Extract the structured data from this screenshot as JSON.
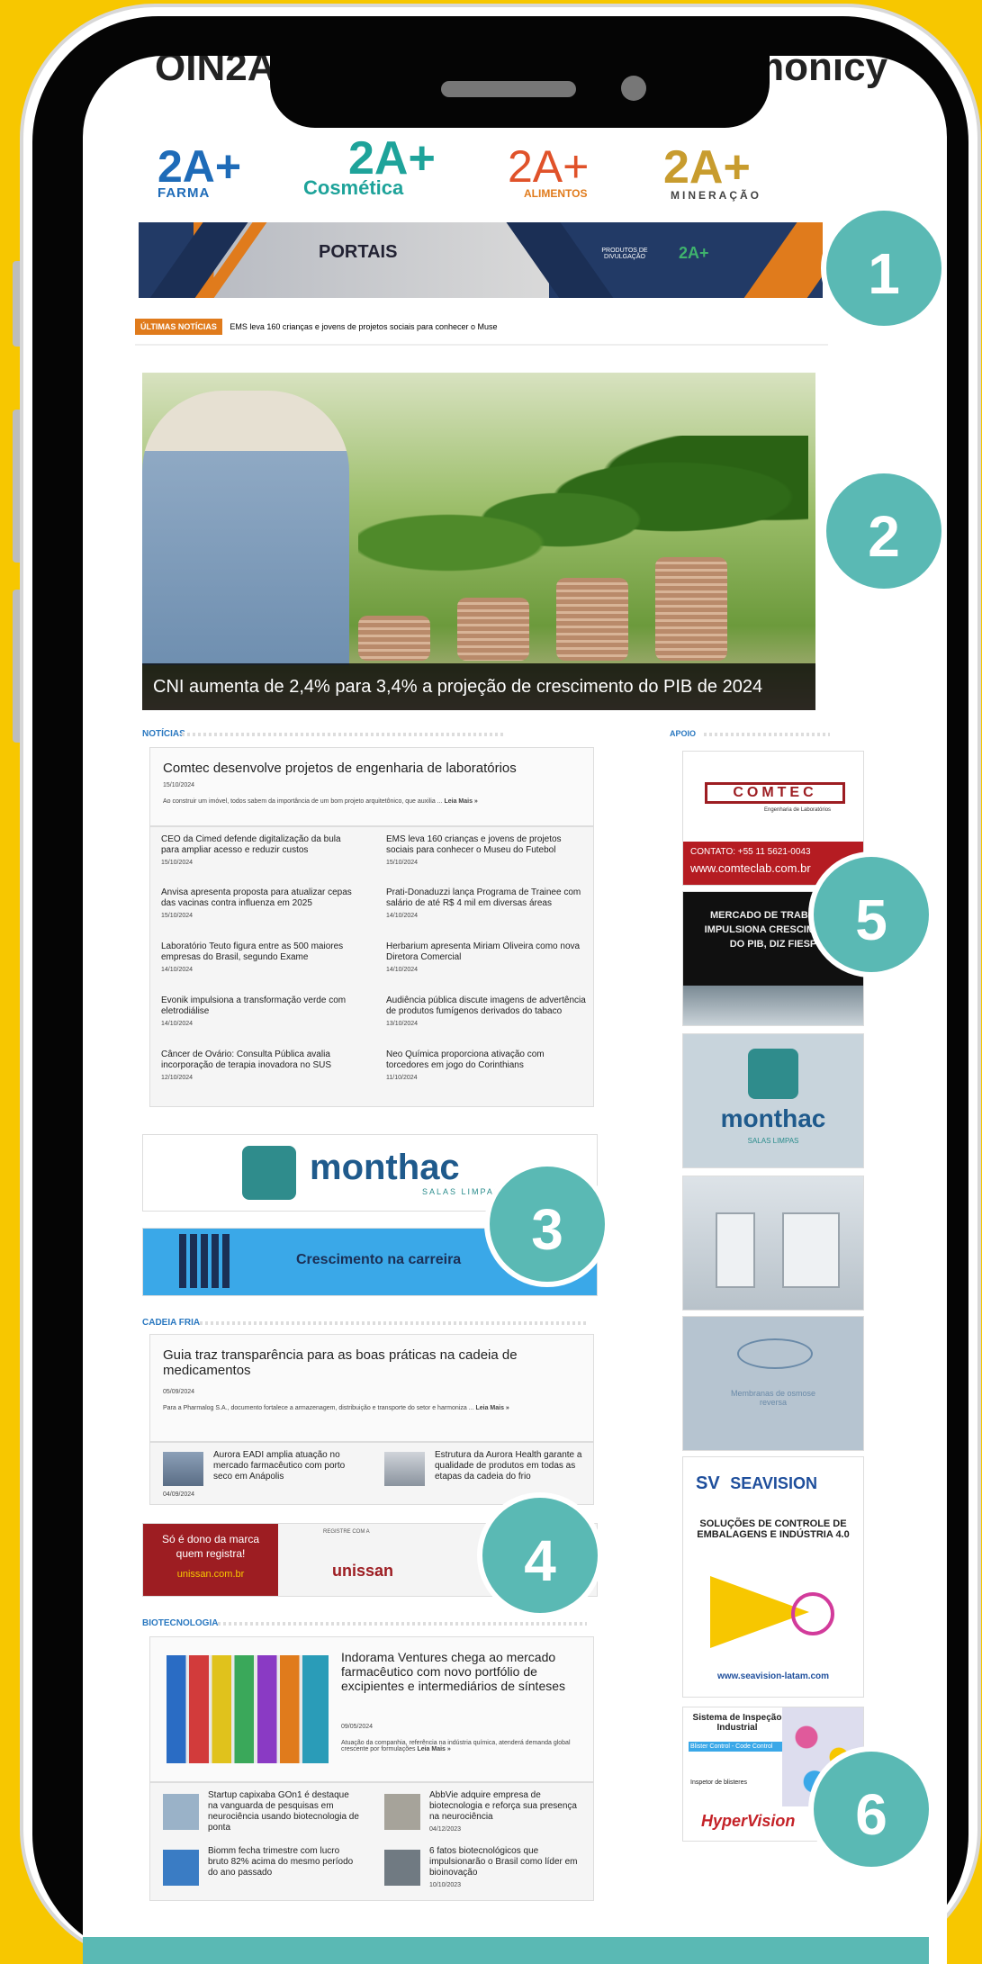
{
  "header": {
    "cut_text_left": "OIN2A",
    "cut_text_right": "monicy"
  },
  "brands": {
    "farma": {
      "main": "2A+",
      "sub": "FARMA"
    },
    "cosmetica": {
      "main": "2A+",
      "sub": "Cosmética"
    },
    "alimentos": {
      "main": "2A+",
      "sub": "ALIMENTOS"
    },
    "mineracao": {
      "main": "2A+",
      "sub": "MINERAÇÃO"
    }
  },
  "banner_portais": {
    "title": "PORTAIS",
    "sub": "PRODUTOS DE DIVULGAÇÃO",
    "brand": "2A+"
  },
  "ticker": {
    "label": "ÚLTIMAS NOTÍCIAS",
    "text": "EMS leva 160 crianças e jovens de projetos sociais para conhecer o Muse"
  },
  "hero": {
    "caption": "CNI aumenta de 2,4% para 3,4% a projeção de crescimento do PIB de 2024"
  },
  "sections": {
    "noticias": "NOTÍCIAS",
    "apoio": "APOIO",
    "cadeia_fria": "CADEIA FRIA",
    "biotecnologia": "BIOTECNOLOGIA"
  },
  "noticias": {
    "headline": "Comtec desenvolve projetos de engenharia de laboratórios",
    "date": "15/10/2024",
    "excerpt": "Ao construir um imóvel, todos sabem da importância de um bom projeto arquitetônico, que auxilia ...",
    "read_more": "Leia Mais »",
    "items": [
      {
        "title": "CEO da Cimed defende digitalização da bula para ampliar acesso e reduzir custos",
        "date": "15/10/2024"
      },
      {
        "title": "EMS leva 160 crianças e jovens de projetos sociais para conhecer o Museu do Futebol",
        "date": "15/10/2024"
      },
      {
        "title": "Anvisa apresenta proposta para atualizar cepas das vacinas contra influenza em 2025",
        "date": "15/10/2024"
      },
      {
        "title": "Prati-Donaduzzi lança Programa de Trainee com salário de até R$ 4 mil em diversas áreas",
        "date": "14/10/2024"
      },
      {
        "title": "Laboratório Teuto figura entre as 500 maiores empresas do Brasil, segundo Exame",
        "date": "14/10/2024"
      },
      {
        "title": "Herbarium apresenta Miriam Oliveira como nova Diretora Comercial",
        "date": "14/10/2024"
      },
      {
        "title": "Evonik impulsiona a transformação verde com eletrodiálise",
        "date": "14/10/2024"
      },
      {
        "title": "Audiência pública discute imagens de advertência de produtos fumígenos derivados do tabaco",
        "date": "13/10/2024"
      },
      {
        "title": "Câncer de Ovário: Consulta Pública avalia incorporação de terapia inovadora no SUS",
        "date": "12/10/2024"
      },
      {
        "title": "Neo Química proporciona ativação com torcedores em jogo do Corinthians",
        "date": "11/10/2024"
      }
    ]
  },
  "ads": {
    "monthac_name": "monthac",
    "monthac_sub": "SALAS LIMPAS",
    "carreira": "Crescimento na carreira",
    "unissan_line1": "Só é dono da marca",
    "unissan_line2": "quem registra!",
    "unissan_url": "unissan.com.br",
    "unissan_tag": "REGISTRE COM A",
    "unissan_name": "unissan",
    "comtec_name": "COMTEC",
    "comtec_sub": "Engenharia de Laboratórios",
    "comtec_contact": "CONTATO: +55 11 5621-0043",
    "comtec_url": "www.comteclab.com.br",
    "mercado_text": "MERCADO DE TRABALHO IMPULSIONA CRESCIMENTO DO PIB, DIZ FIESP",
    "membranas": "Membranas de osmose reversa",
    "seavision_name": "SEAVISION",
    "seavision_text": "SOLUÇÕES DE CONTROLE DE EMBALAGENS E INDÚSTRIA 4.0",
    "seavision_url": "www.seavision-latam.com",
    "hyper_title": "Sistema de Inspeção Industrial",
    "hyper_sub": "Blister Control - Code Control",
    "hyper_insp": "Inspetor de blisteres",
    "hyper_name": "HyperVision"
  },
  "cadeia_fria": {
    "headline": "Guia traz transparência para as boas práticas na cadeia de medicamentos",
    "date": "05/09/2024",
    "excerpt": "Para a Pharmalog S.A., documento fortalece a armazenagem, distribuição e transporte do setor e harmoniza ...",
    "read_more": "Leia Mais »",
    "items": [
      {
        "title": "Aurora EADI amplia atuação no mercado farmacêutico com porto seco em Anápolis",
        "date": "04/09/2024"
      },
      {
        "title": "Estrutura da Aurora Health garante a qualidade de produtos em todas as etapas da cadeia do frio",
        "date": ""
      }
    ]
  },
  "biotecnologia": {
    "headline": "Indorama Ventures chega ao mercado farmacêutico com novo portfólio de excipientes e intermediários de sínteses",
    "date": "09/05/2024",
    "excerpt": "Atuação da companhia, referência na indústria química, atenderá demanda global crescente por formulações",
    "read_more": "Leia Mais »",
    "items": [
      {
        "title": "Startup capixaba GOn1 é destaque na vanguarda de pesquisas em neurociência usando biotecnologia de ponta",
        "date": ""
      },
      {
        "title": "AbbVie adquire empresa de biotecnologia e reforça sua presença na neurociência",
        "date": "04/12/2023"
      },
      {
        "title": "Biomm fecha trimestre com lucro bruto 82% acima do mesmo período do ano passado",
        "date": ""
      },
      {
        "title": "6 fatos biotecnológicos que impulsionarão o Brasil como líder em bioinovação",
        "date": "10/10/2023"
      }
    ]
  },
  "callouts": [
    "1",
    "2",
    "3",
    "4",
    "5",
    "6"
  ],
  "colors": {
    "background": "#f7c700",
    "callout": "#5ab9b4",
    "accent_blue": "#2a78c0",
    "accent_orange": "#e07b1c"
  }
}
